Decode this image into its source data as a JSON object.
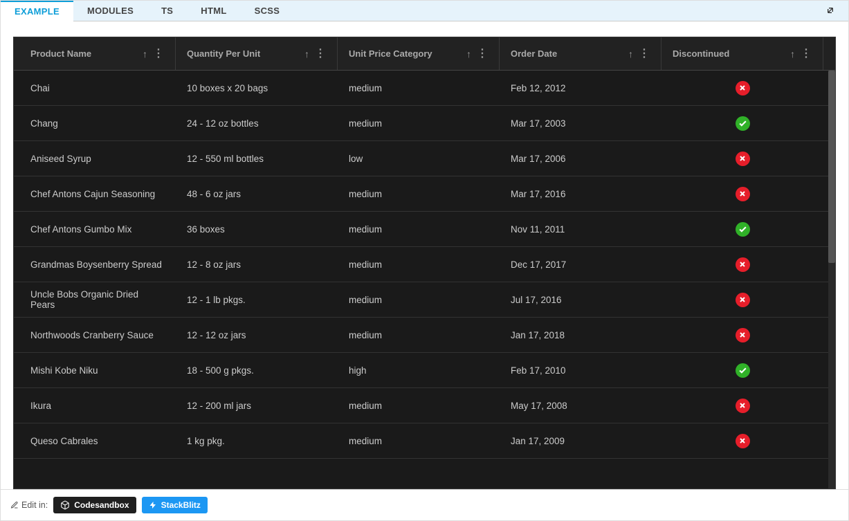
{
  "tabs": [
    {
      "label": "EXAMPLE",
      "active": true
    },
    {
      "label": "MODULES",
      "active": false
    },
    {
      "label": "TS",
      "active": false
    },
    {
      "label": "HTML",
      "active": false
    },
    {
      "label": "SCSS",
      "active": false
    }
  ],
  "columns": [
    {
      "label": "Product Name",
      "key": "col-name"
    },
    {
      "label": "Quantity Per Unit",
      "key": "col-qty"
    },
    {
      "label": "Unit Price Category",
      "key": "col-price"
    },
    {
      "label": "Order Date",
      "key": "col-date"
    },
    {
      "label": "Discontinued",
      "key": "col-disc"
    }
  ],
  "rows": [
    {
      "name": "Chai",
      "qty": "10 boxes x 20 bags",
      "price": "medium",
      "date": "Feb 12, 2012",
      "disc": false
    },
    {
      "name": "Chang",
      "qty": "24 - 12 oz bottles",
      "price": "medium",
      "date": "Mar 17, 2003",
      "disc": true
    },
    {
      "name": "Aniseed Syrup",
      "qty": "12 - 550 ml bottles",
      "price": "low",
      "date": "Mar 17, 2006",
      "disc": false
    },
    {
      "name": "Chef Antons Cajun Seasoning",
      "qty": "48 - 6 oz jars",
      "price": "medium",
      "date": "Mar 17, 2016",
      "disc": false
    },
    {
      "name": "Chef Antons Gumbo Mix",
      "qty": "36 boxes",
      "price": "medium",
      "date": "Nov 11, 2011",
      "disc": true
    },
    {
      "name": "Grandmas Boysenberry Spread",
      "qty": "12 - 8 oz jars",
      "price": "medium",
      "date": "Dec 17, 2017",
      "disc": false
    },
    {
      "name": "Uncle Bobs Organic Dried Pears",
      "qty": "12 - 1 lb pkgs.",
      "price": "medium",
      "date": "Jul 17, 2016",
      "disc": false
    },
    {
      "name": "Northwoods Cranberry Sauce",
      "qty": "12 - 12 oz jars",
      "price": "medium",
      "date": "Jan 17, 2018",
      "disc": false
    },
    {
      "name": "Mishi Kobe Niku",
      "qty": "18 - 500 g pkgs.",
      "price": "high",
      "date": "Feb 17, 2010",
      "disc": true
    },
    {
      "name": "Ikura",
      "qty": "12 - 200 ml jars",
      "price": "medium",
      "date": "May 17, 2008",
      "disc": false
    },
    {
      "name": "Queso Cabrales",
      "qty": "1 kg pkg.",
      "price": "medium",
      "date": "Jan 17, 2009",
      "disc": false
    }
  ],
  "footer": {
    "editLabel": "Edit in:",
    "codesandbox": "Codesandbox",
    "stackblitz": "StackBlitz"
  }
}
